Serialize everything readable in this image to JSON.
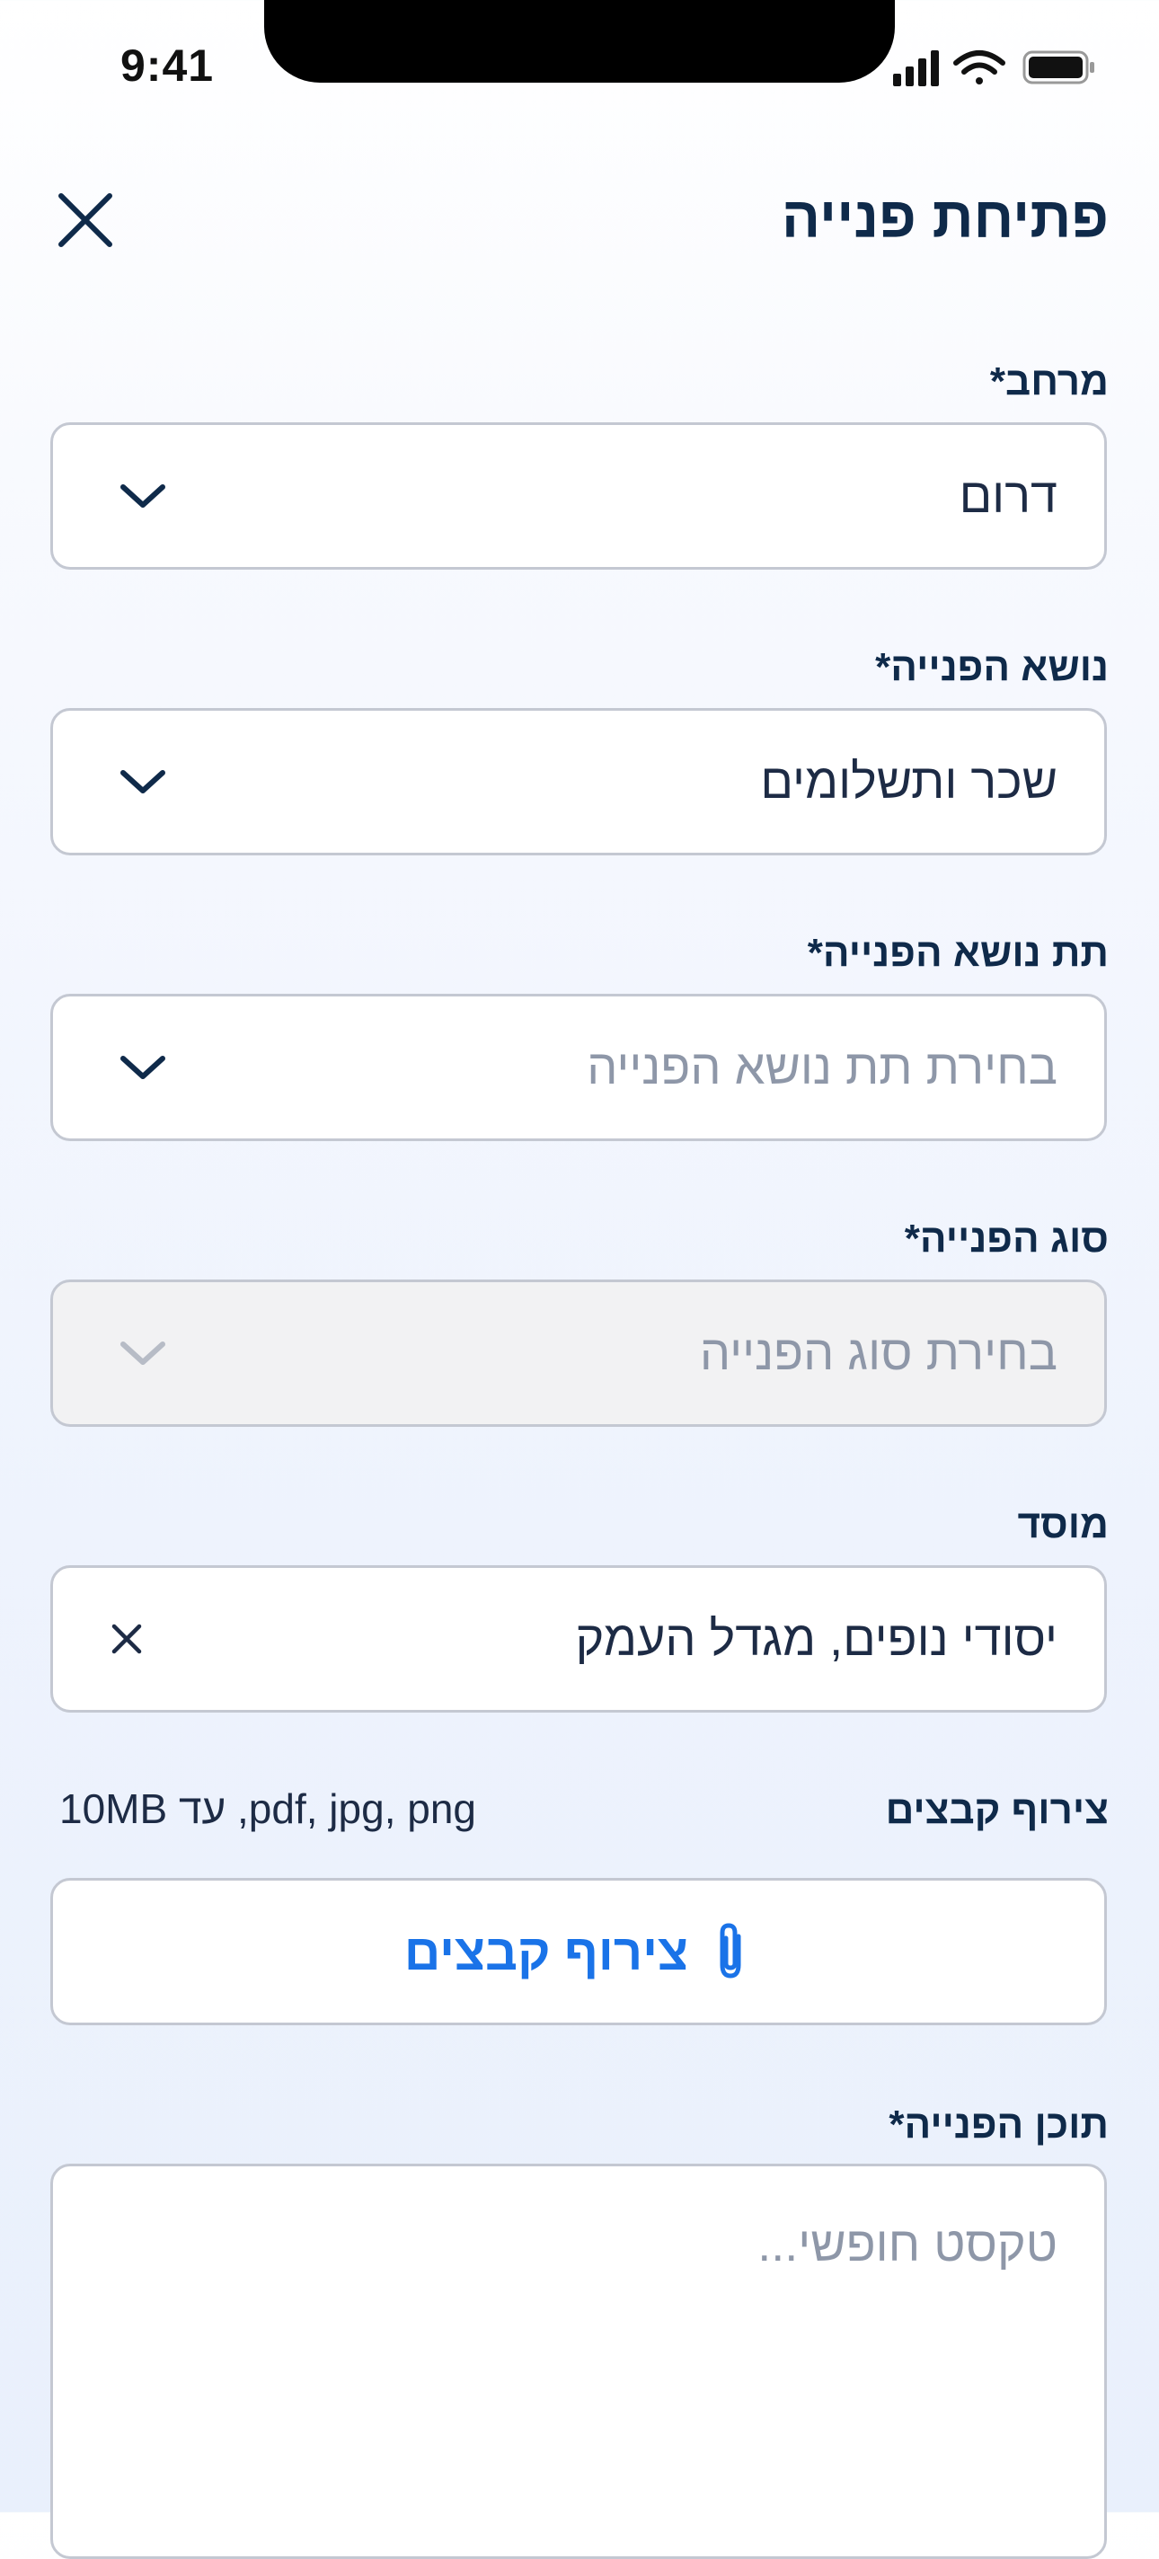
{
  "status_bar": {
    "time": "9:41"
  },
  "header": {
    "title": "פתיחת פנייה"
  },
  "fields": [
    {
      "label": "מרחב*",
      "value": "דרום",
      "is_placeholder": false
    },
    {
      "label": "נושא הפנייה*",
      "value": "שכר ותשלומים",
      "is_placeholder": false
    },
    {
      "label": "תת נושא הפנייה*",
      "value": "בחירת תת נושא הפנייה",
      "is_placeholder": true
    },
    {
      "label": "סוג הפנייה*",
      "value": "בחירת סוג הפנייה",
      "is_placeholder": true,
      "disabled": true
    },
    {
      "label": "מוסד",
      "value": "יסודי נופים, מגדל העמק",
      "is_placeholder": false
    }
  ],
  "attachments": {
    "label": "צירוף קבצים",
    "hint": "10MB עד ,pdf, jpg, png",
    "button_label": "צירוף קבצים"
  },
  "content": {
    "label": "תוכן הפנייה*",
    "placeholder": "טקסט חופשי..."
  },
  "colors": {
    "primary_text": "#0f2a4a",
    "accent": "#1a73e8",
    "border": "#c4c8d2",
    "placeholder": "#8e97a8",
    "disabled_bg": "#f2f2f3"
  }
}
